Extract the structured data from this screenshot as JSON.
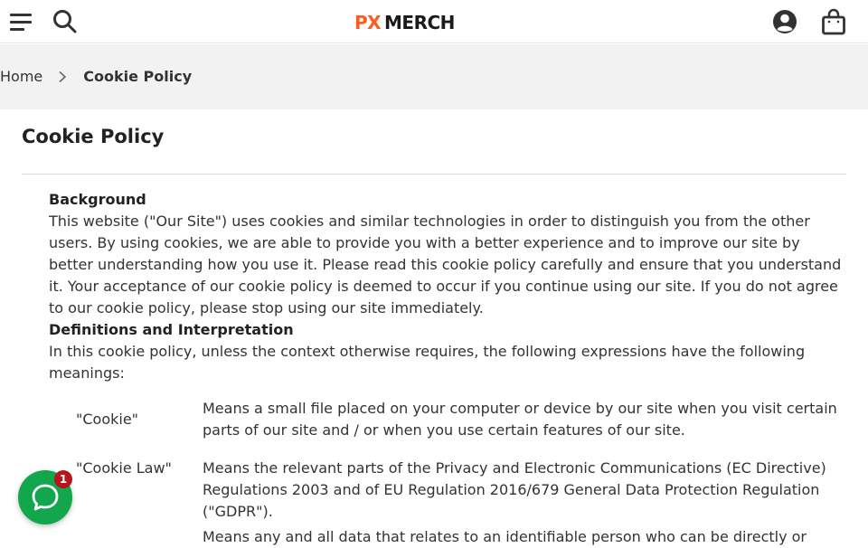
{
  "header": {
    "brand": "PXMERCH",
    "brand_colors": {
      "px": "#ff5a1f",
      "merch": "#1a1a1a"
    }
  },
  "breadcrumb": {
    "home": "Home",
    "current": "Cookie Policy"
  },
  "page": {
    "title": "Cookie Policy",
    "sections": [
      {
        "heading": "Background",
        "text": "This website (\"Our Site\") uses cookies and similar technologies in order to distinguish you from the other users. By using cookies, we are able to provide you with a better experience and to improve our site by better understanding how you use it. Please read this cookie policy carefully and ensure that you understand it. Your acceptance of our cookie policy is deemed to occur if you continue using our site. If you do not agree to our cookie policy, please stop using our site immediately."
      },
      {
        "heading": "Definitions and Interpretation",
        "text": "In this cookie policy, unless the context otherwise requires, the following expressions have the following meanings:"
      }
    ],
    "definitions": [
      {
        "term": "\"Cookie\"",
        "desc": "Means a small file placed on your computer or device by our site when you visit certain parts of our site and / or when you use certain features of our site."
      },
      {
        "term": "\"Cookie Law\"",
        "desc": "Means the relevant parts of the Privacy and Electronic Communications (EC Directive) Regulations 2003 and of EU Regulation 2016/679 General Data Protection Regulation (\"GDPR\")."
      },
      {
        "term": "",
        "desc": "Means any and all data that relates to an identifiable person who can be directly or"
      }
    ]
  },
  "chat": {
    "badge_count": "1",
    "accent": "#12a64d",
    "badge_color": "#b4161b"
  },
  "icons": [
    "menu-icon",
    "search-icon",
    "account-icon",
    "cart-icon",
    "chevron-right-icon",
    "chat-icon"
  ]
}
